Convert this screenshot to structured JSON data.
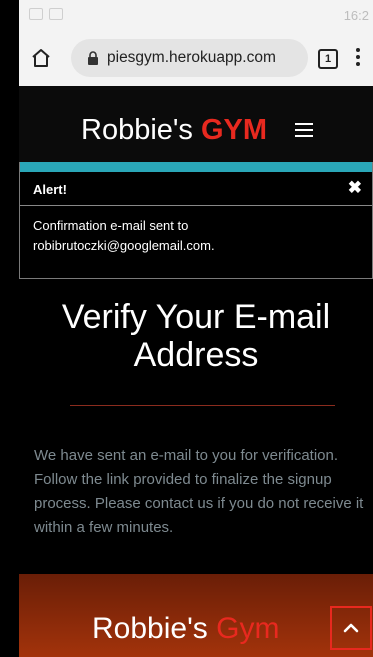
{
  "status_bar": {
    "time": "16:2"
  },
  "browser": {
    "url": "piesgym.herokuapp.com",
    "tab_count": "1"
  },
  "header": {
    "brand_prefix": "Robbie's",
    "brand_accent": "GYM"
  },
  "alert": {
    "title": "Alert!",
    "close_symbol": "✖",
    "message": "Confirmation e-mail sent to robibrutoczki@googlemail.com."
  },
  "main": {
    "title": "Verify Your E-mail Address",
    "description": "We have sent an e-mail to you for verification. Follow the link provided to finalize the signup process. Please contact us if you do not receive it within a few minutes."
  },
  "footer": {
    "brand_prefix": "Robbie's",
    "brand_accent": "Gym"
  },
  "colors": {
    "accent_red": "#e8291f",
    "alert_teal": "#2aa7b8",
    "footer_brown": "#a3330b",
    "muted_text": "#7e8a90"
  },
  "icons": [
    "home-icon",
    "lock-icon",
    "tabs-icon",
    "more-vert-icon",
    "hamburger-icon",
    "close-icon",
    "chevron-up-icon"
  ]
}
